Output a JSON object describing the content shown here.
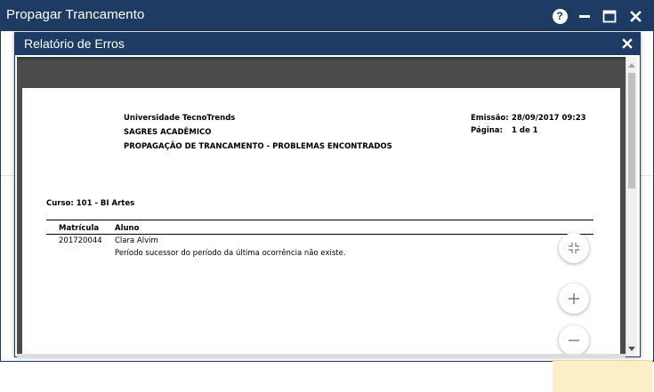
{
  "outer_window": {
    "title": "Propagar Trancamento",
    "help_label": "?"
  },
  "dialog": {
    "title": "Relatório de Erros"
  },
  "report": {
    "institution": "Universidade TecnoTrends",
    "system": "SAGRES ACADÊMICO",
    "report_title": "PROPAGAÇÃO DE TRANCAMENTO - PROBLEMAS ENCONTRADOS",
    "emission_label": "Emissão:",
    "emission_value": "28/09/2017 09:23",
    "page_label": "Página:",
    "page_value": "1 de 1",
    "course": "Curso: 101 - BI Artes",
    "columns": [
      "Matrícula",
      "Aluno"
    ],
    "rows": [
      {
        "matricula": "201720044",
        "aluno": "Clara Alvim",
        "message": "Período sucessor do período da última ocorrência  não existe."
      }
    ]
  },
  "icons": {
    "help": "help-icon",
    "minimize": "minimize-icon",
    "maximize": "maximize-icon",
    "close": "close-icon",
    "collapse": "collapse-icon",
    "zoom_in": "zoom-in-icon",
    "zoom_out": "zoom-out-icon"
  }
}
